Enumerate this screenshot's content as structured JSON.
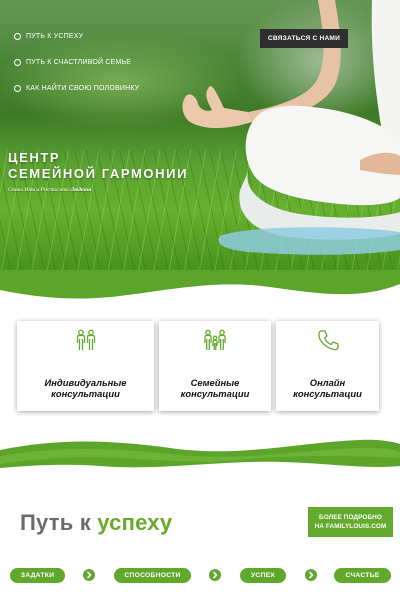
{
  "hero": {
    "nav": [
      {
        "label": "ПУТЬ К УСПЕХУ"
      },
      {
        "label": "ПУТЬ К СЧАСТЛИВОЙ СЕМЬЕ"
      },
      {
        "label": "КАК НАЙТИ СВОЮ ПОЛОВИНКУ"
      }
    ],
    "contact_label": "СВЯЗАТЬСЯ С НАМИ",
    "title_line1": "ЦЕНТР",
    "title_line2": "СЕМЕЙНОЙ ГАРМОНИИ",
    "subtitle_prefix": "Семьи Ины и Ростислава ",
    "subtitle_bold": "Людвиш"
  },
  "services": [
    {
      "icon": "couple-icon",
      "line1": "Индивидуальные",
      "line2": "консультации"
    },
    {
      "icon": "family-icon",
      "line1": "Семейные",
      "line2": "консультации"
    },
    {
      "icon": "phone-icon",
      "line1": "Онлайн",
      "line2": "консультации"
    }
  ],
  "path": {
    "title_plain": "Путь к ",
    "title_accent": "успеху",
    "more_line1": "БОЛЕЕ ПОДРОБНО",
    "more_line2": "НА FAMILYLOUIS.COM",
    "steps": [
      {
        "label": "ЗАДАТКИ"
      },
      {
        "label": "СПОСОБНОСТИ"
      },
      {
        "label": "УСПЕХ"
      },
      {
        "label": "СЧАСТЬЕ"
      }
    ]
  },
  "colors": {
    "accent_green": "#64aa2c",
    "dark_button": "#2e2e2e",
    "heading_gray": "#6b6b6b"
  }
}
